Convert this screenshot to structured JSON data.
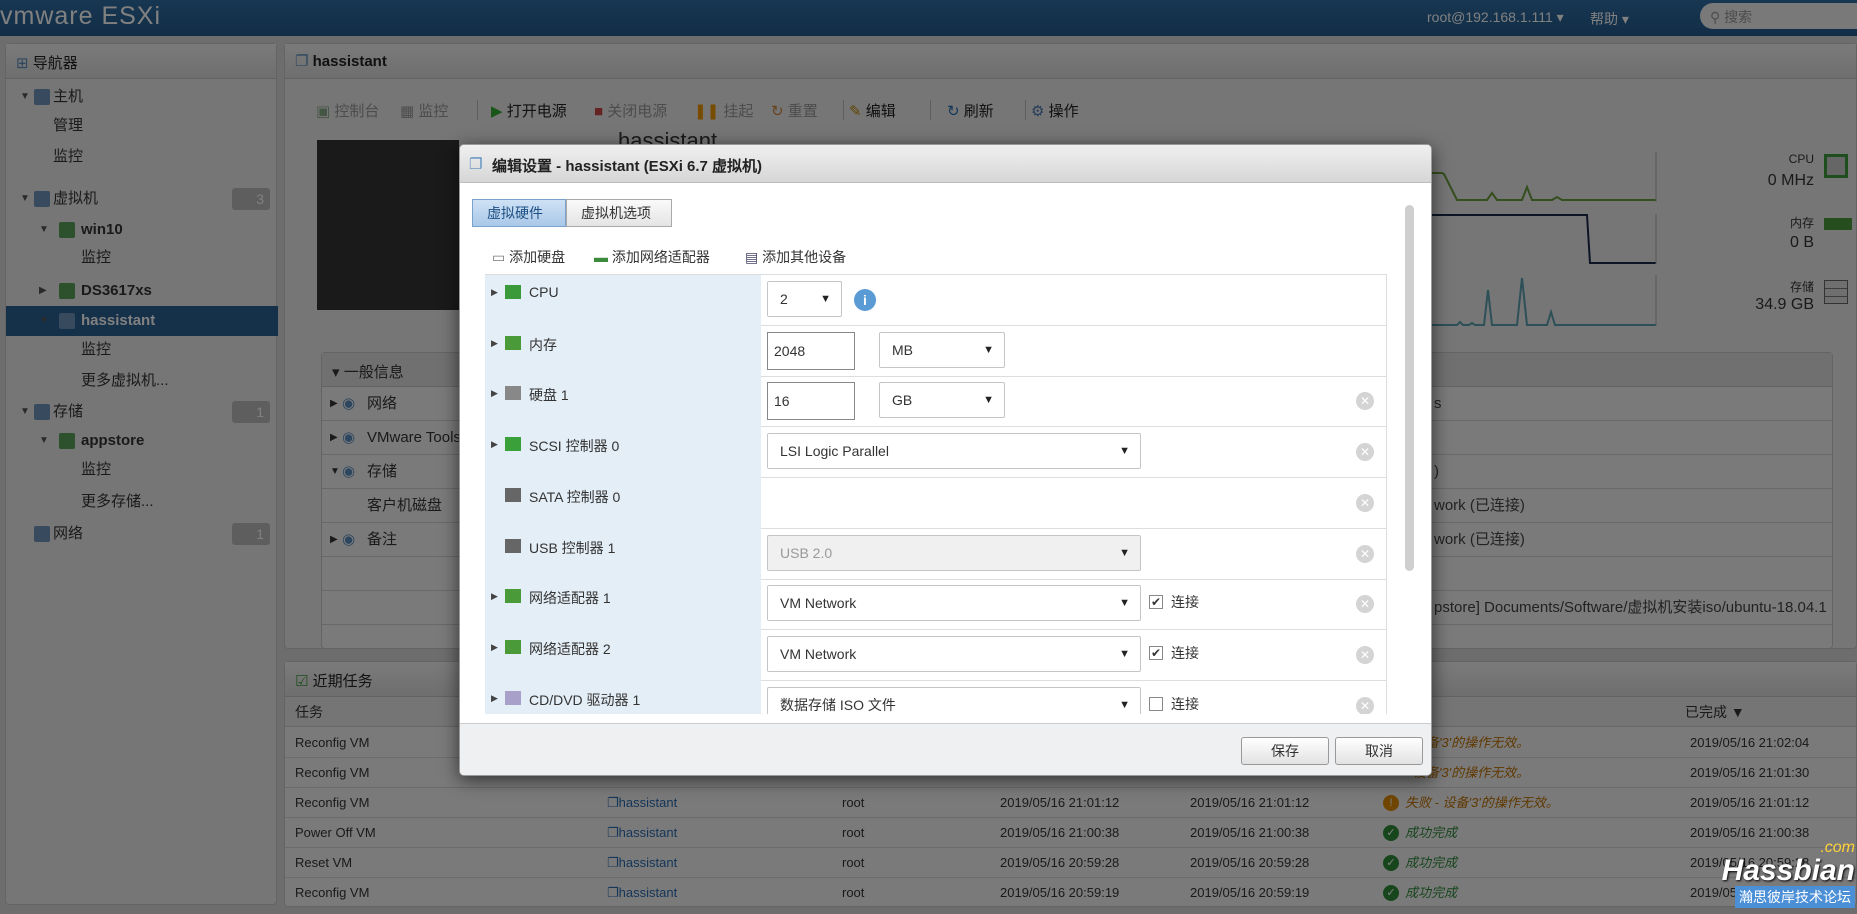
{
  "topbar": {
    "logo": "vmware ESXi",
    "user": "root@192.168.1.111 ▾",
    "help": "帮助 ▾",
    "search_placeholder": "搜索"
  },
  "navigator": {
    "title": "导航器",
    "items": [
      {
        "label": "主机",
        "level": 0,
        "arrow": "▼"
      },
      {
        "label": "管理",
        "level": "sub0"
      },
      {
        "label": "监控",
        "level": "sub0"
      },
      {
        "label": "虚拟机",
        "level": 0,
        "arrow": "▼",
        "badge": "3"
      },
      {
        "label": "win10",
        "level": 1,
        "arrow": "▼"
      },
      {
        "label": "监控",
        "level": "sub1"
      },
      {
        "label": "DS3617xs",
        "level": 1,
        "arrow": "▶"
      },
      {
        "label": "hassistant",
        "level": 1,
        "arrow": "▼",
        "selected": true
      },
      {
        "label": "监控",
        "level": "sub1"
      },
      {
        "label": "更多虚拟机...",
        "level": "sub1"
      },
      {
        "label": "存储",
        "level": 0,
        "arrow": "▼",
        "badge": "1"
      },
      {
        "label": "appstore",
        "level": 1,
        "arrow": "▼"
      },
      {
        "label": "监控",
        "level": "sub1"
      },
      {
        "label": "更多存储...",
        "level": "sub1"
      },
      {
        "label": "网络",
        "level": 0,
        "arrow": "",
        "badge": "1"
      }
    ]
  },
  "vm": {
    "title": "hassistant",
    "toolbar": [
      "控制台",
      "监控",
      "打开电源",
      "关闭电源",
      "挂起",
      "重置",
      "编辑",
      "刷新",
      "操作"
    ],
    "stats": {
      "cpu_label": "CPU",
      "cpu_value": "0 MHz",
      "mem_label": "内存",
      "mem_value": "0 B",
      "storage_label": "存储",
      "storage_value": "34.9 GB"
    },
    "general": {
      "title": "一般信息",
      "rows": [
        "网络",
        "VMware Tools",
        "存储",
        "客户机磁盘",
        "备注"
      ],
      "values": [
        "s",
        "",
        ")",
        "work (已连接)",
        "work (已连接)",
        "",
        "pstore] Documents/Software/虚拟机安装iso/ubuntu-18.04.1"
      ]
    }
  },
  "dialog": {
    "title": "编辑设置 - hassistant (ESXi 6.7 虚拟机)",
    "tabs": [
      "虚拟硬件",
      "虚拟机选项"
    ],
    "add": [
      "添加硬盘",
      "添加网络适配器",
      "添加其他设备"
    ],
    "hardware": [
      {
        "label": "CPU",
        "icon": "cpu-icon",
        "select": "2"
      },
      {
        "label": "内存",
        "icon": "memory-icon",
        "input": "2048",
        "unit": "MB"
      },
      {
        "label": "硬盘 1",
        "icon": "disk-icon",
        "input": "16",
        "unit": "GB",
        "removable": true
      },
      {
        "label": "SCSI 控制器 0",
        "icon": "scsi-icon",
        "select": "LSI Logic Parallel",
        "removable": true
      },
      {
        "label": "SATA 控制器 0",
        "icon": "sata-icon",
        "removable": true
      },
      {
        "label": "USB 控制器 1",
        "icon": "usb-icon",
        "select": "USB 2.0",
        "disabled": true,
        "removable": true
      },
      {
        "label": "网络适配器 1",
        "icon": "nic-icon",
        "select": "VM Network",
        "connect": "连接",
        "checked": true,
        "removable": true
      },
      {
        "label": "网络适配器 2",
        "icon": "nic-icon",
        "select": "VM Network",
        "connect": "连接",
        "checked": true,
        "removable": true
      },
      {
        "label": "CD/DVD 驱动器 1",
        "icon": "cdrom-icon",
        "select": "数据存储 ISO 文件",
        "connect": "连接",
        "checked": false,
        "removable": true
      }
    ],
    "save": "保存",
    "cancel": "取消"
  },
  "tasks": {
    "title": "近期任务",
    "headers": [
      "任务",
      "已完成 ▼"
    ],
    "rows": [
      {
        "task": "Reconfig VM",
        "result": "- 设备'3'的操作无效。",
        "completed": "2019/05/16 21:02:04"
      },
      {
        "task": "Reconfig VM",
        "result": "- 设备'3'的操作无效。",
        "completed": "2019/05/16 21:01:30"
      },
      {
        "task": "Reconfig VM",
        "target": "hassistant",
        "initiator": "root",
        "queued": "2019/05/16 21:01:12",
        "started": "2019/05/16 21:01:12",
        "status": "fail",
        "result": "失败 - 设备'3'的操作无效。",
        "completed": "2019/05/16 21:01:12"
      },
      {
        "task": "Power Off VM",
        "target": "hassistant",
        "initiator": "root",
        "queued": "2019/05/16 21:00:38",
        "started": "2019/05/16 21:00:38",
        "status": "ok",
        "result": "成功完成",
        "completed": "2019/05/16 21:00:38"
      },
      {
        "task": "Reset VM",
        "target": "hassistant",
        "initiator": "root",
        "queued": "2019/05/16 20:59:28",
        "started": "2019/05/16 20:59:28",
        "status": "ok",
        "result": "成功完成",
        "completed": "2019/05/16 20:59:28"
      },
      {
        "task": "Reconfig VM",
        "target": "hassistant",
        "initiator": "root",
        "queued": "2019/05/16 20:59:19",
        "started": "2019/05/16 20:59:19",
        "status": "ok",
        "result": "成功完成",
        "completed": "2019/05/16 20:59:19"
      }
    ]
  },
  "watermark": {
    "brand": "Hassbian",
    "tld": ".com",
    "slogan": "瀚思彼岸技术论坛"
  },
  "colors": {
    "header": "#2b6aa0",
    "selected": "#2a5f92",
    "accent": "#1d4f82"
  }
}
